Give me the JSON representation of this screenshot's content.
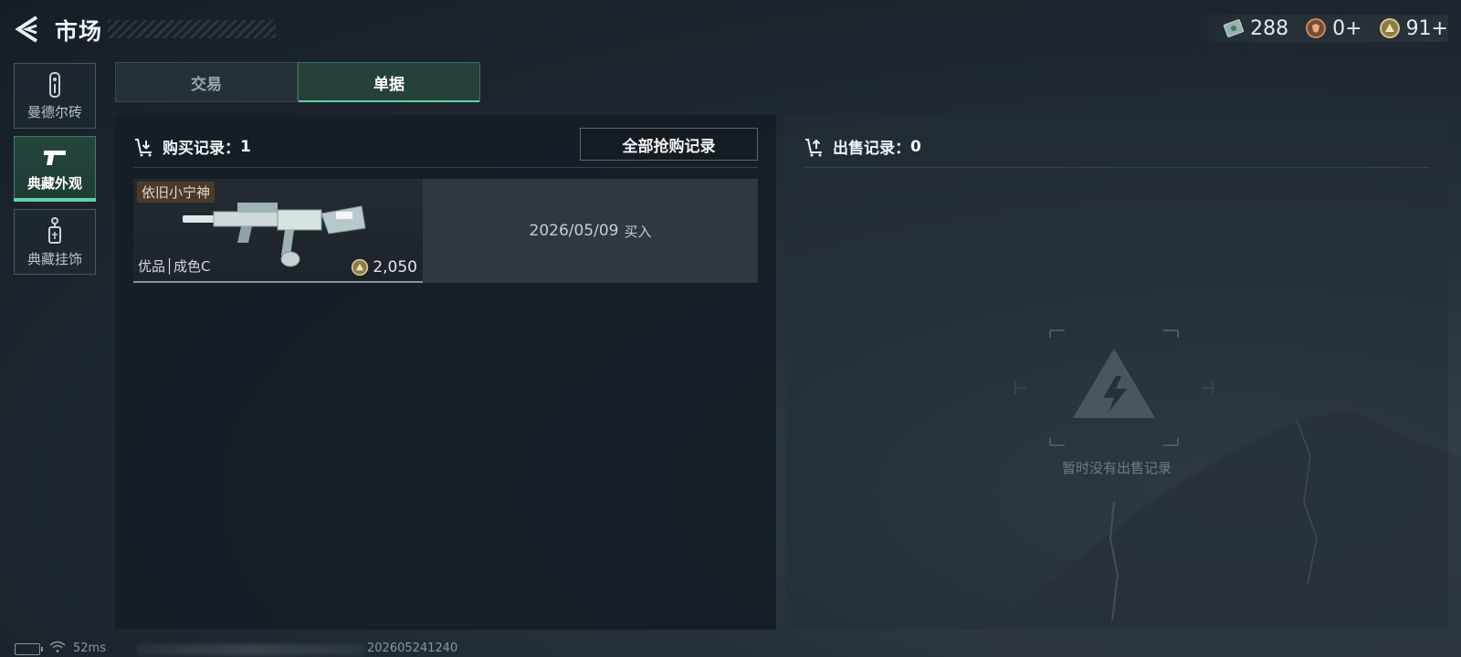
{
  "header": {
    "title": "市场",
    "currencies": [
      {
        "icon": "cash-ticket-icon",
        "amount": "288"
      },
      {
        "icon": "bronze-medal-icon",
        "amount": "0+"
      },
      {
        "icon": "gold-coin-icon",
        "amount": "91+"
      }
    ]
  },
  "sidebar": {
    "items": [
      {
        "label": "曼德尔砖",
        "icon": "mandel-brick-icon"
      },
      {
        "label": "典藏外观",
        "icon": "pistol-icon"
      },
      {
        "label": "典藏挂饰",
        "icon": "charm-tag-icon"
      }
    ],
    "active_index": 1
  },
  "tabs": [
    {
      "label": "交易"
    },
    {
      "label": "单据"
    }
  ],
  "active_tab": 1,
  "purchase": {
    "label": "购买记录：",
    "count": "1",
    "all_records_button": "全部抢购记录",
    "records": [
      {
        "tag": "依旧小宁神",
        "quality": "优品│成色C",
        "price": "2,050",
        "date": "2026/05/09",
        "action": "买入"
      }
    ]
  },
  "sales": {
    "label": "出售记录：",
    "count": "0",
    "empty_text": "暂时没有出售记录"
  },
  "footer": {
    "ping": "52ms",
    "build": "202605241240"
  },
  "colors": {
    "accent": "#5fd3a8",
    "tag_bg": "#4a3a2c"
  }
}
